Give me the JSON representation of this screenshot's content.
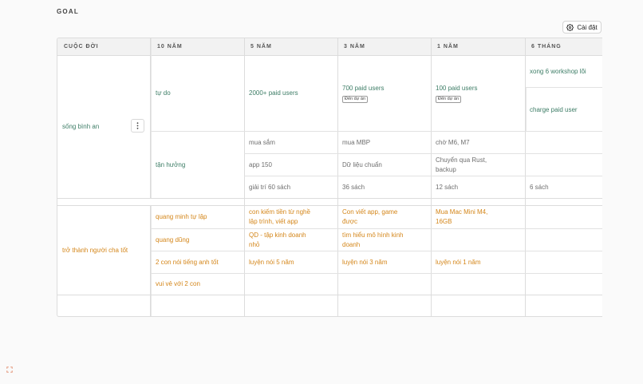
{
  "page": {
    "title": "GOAL"
  },
  "toolbar": {
    "settings_label": "Cài đặt"
  },
  "table": {
    "headers": [
      "CUỘC ĐỜI",
      "10 NĂM",
      "5 NĂM",
      "3 NĂM",
      "1 NĂM",
      "6 THÁNG"
    ],
    "groups": [
      {
        "label": "sống bình an"
      },
      {
        "label": "trở thành người cha tốt"
      }
    ],
    "cells": {
      "g1_10y_a": "tự do",
      "g1_5y_a": "2000+ paid users",
      "g1_3y_a": "700 paid users",
      "g1_3y_a_badge": "Đến dự án",
      "g1_1y_a": "100 paid users",
      "g1_1y_a_badge": "Đến dự án",
      "g1_6m_a1": "xong 6 workshop lõi",
      "g1_6m_a2": "charge paid user",
      "g1_10y_b": "tận hưởng",
      "g1_5y_b1": "mua sắm",
      "g1_3y_b1": "mua MBP",
      "g1_1y_b1": "chờ M6, M7",
      "g1_5y_b2": "app 150",
      "g1_3y_b2": "Dữ liệu chuẩn",
      "g1_1y_b2": "Chuyển qua Rust, backup",
      "g1_5y_b3": "giải trí 60 sách",
      "g1_3y_b3": "36 sách",
      "g1_1y_b3": "12 sách",
      "g1_6m_b3": "6 sách",
      "g2_10y_1": "quang minh tự lập",
      "g2_5y_1": "con kiếm tiền từ nghề lập trình, viết app",
      "g2_3y_1": "Con viết app, game được",
      "g2_1y_1": "Mua Mac Mini M4, 16GB",
      "g2_10y_2": "quang dũng",
      "g2_5y_2": "QD - tập kinh doanh nhỏ",
      "g2_3y_2": "tìm hiểu mô hình kinh doanh",
      "g2_10y_3": "2 con nói tiếng anh tốt",
      "g2_5y_3": "luyện nói 5 năm",
      "g2_3y_3": "luyện nói 3 năm",
      "g2_1y_3": "luyện nói 1 năm",
      "g2_10y_4": "vui vẻ với 2 con"
    }
  },
  "colors": {
    "green": "#3d7d66",
    "orange": "#d4861a"
  },
  "icons": {
    "settings": "gear-icon",
    "row_menu": "more-vertical-icon",
    "corner": "expand-icon"
  }
}
